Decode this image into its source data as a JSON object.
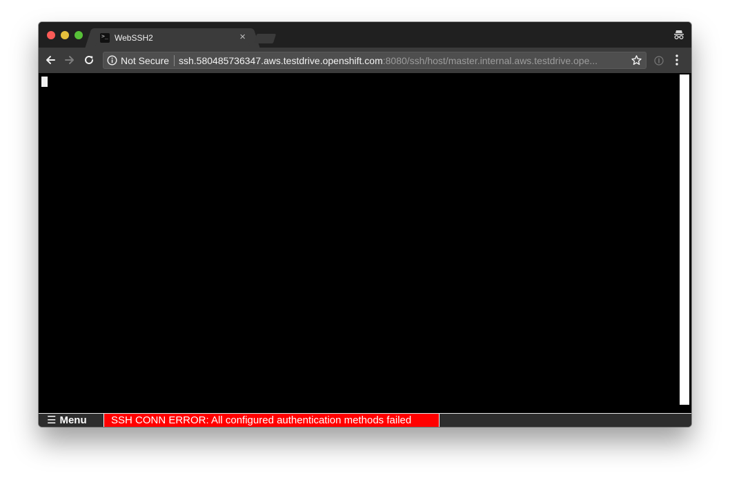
{
  "browser": {
    "tab": {
      "favicon": "terminal-icon",
      "title": "WebSSH2",
      "close_glyph": "×"
    },
    "omnibox": {
      "security_label": "Not Secure",
      "url_host": "ssh.580485736347.aws.testdrive.openshift.com",
      "url_path": ":8080/ssh/host/master.internal.aws.testdrive.ope..."
    },
    "icons": {
      "back": "arrow-left-icon",
      "forward": "arrow-right-icon",
      "reload": "reload-icon",
      "info": "info-icon",
      "bookmark": "star-icon",
      "extension": "extension-icon",
      "more": "more-vertical-icon",
      "incognito": "incognito-icon"
    }
  },
  "terminal": {
    "background": "#000000",
    "foreground": "#f0f0f0"
  },
  "footer": {
    "menu_glyph": "☰",
    "menu_label": "Menu",
    "error_message": "SSH CONN ERROR: All configured authentication methods failed",
    "error_color": "#ff0000"
  }
}
